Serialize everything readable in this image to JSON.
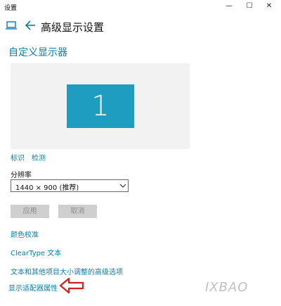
{
  "window": {
    "app_name": "设置",
    "controls": {
      "minimize": "—",
      "maximize": "☐",
      "close": "✕"
    }
  },
  "header": {
    "title": "高级显示设置",
    "icons": [
      "home-icon",
      "back-icon"
    ]
  },
  "section_title": "自定义显示器",
  "monitor": {
    "number": "1"
  },
  "display_links": {
    "identify": "标识",
    "detect": "检测"
  },
  "resolution": {
    "label": "分辨率",
    "value": "1440 × 900 (推荐)"
  },
  "buttons": {
    "apply": "应用",
    "cancel": "取消"
  },
  "links": {
    "color_calibration": "颜色校准",
    "cleartype": "ClearType 文本",
    "advanced_sizing": "文本和其他项目大小调整的高级选项",
    "adapter_properties": "显示适配器属性"
  },
  "watermark": "IXBAO",
  "colors": {
    "accent": "#0a7ca6",
    "monitor_tile": "#1e9dc0",
    "annotation_arrow": "#cc2222"
  }
}
